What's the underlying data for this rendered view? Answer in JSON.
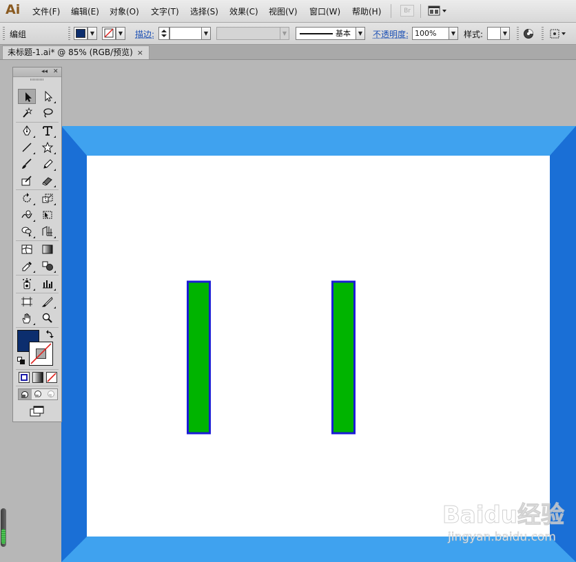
{
  "app": {
    "logo": "Ai"
  },
  "menu": [
    {
      "label": "文件(F)"
    },
    {
      "label": "编辑(E)"
    },
    {
      "label": "对象(O)"
    },
    {
      "label": "文字(T)"
    },
    {
      "label": "选择(S)"
    },
    {
      "label": "效果(C)"
    },
    {
      "label": "视图(V)"
    },
    {
      "label": "窗口(W)"
    },
    {
      "label": "帮助(H)"
    }
  ],
  "menubar_extra": {
    "bridge_label": "Br"
  },
  "control": {
    "selection_label": "编组",
    "fill_color": "#0c2e6e",
    "stroke_label": "描边:",
    "stroke_profile": "基本",
    "opacity_label": "不透明度:",
    "opacity_value": "100%",
    "style_label": "样式:"
  },
  "document_tab": {
    "title": "未标题-1.ai* @ 85% (RGB/预览)",
    "close": "×"
  },
  "artwork": {
    "frame_outer_color": "#1a6fd6",
    "frame_inner_color": "#3fa2ef",
    "page_color": "#ffffff",
    "bar_fill": "#00b400",
    "bar_stroke": "#1c1cd6"
  },
  "tools_panel": {
    "collapse": "◂◂",
    "close": "✕",
    "tools": [
      {
        "name": "selection-tool-icon"
      },
      {
        "name": "direct-selection-tool-icon"
      },
      {
        "name": "magic-wand-tool-icon"
      },
      {
        "name": "lasso-tool-icon"
      },
      {
        "name": "pen-tool-icon"
      },
      {
        "name": "type-tool-icon"
      },
      {
        "name": "line-segment-tool-icon"
      },
      {
        "name": "star-tool-icon"
      },
      {
        "name": "paintbrush-tool-icon"
      },
      {
        "name": "pencil-tool-icon"
      },
      {
        "name": "blob-brush-tool-icon"
      },
      {
        "name": "eraser-tool-icon"
      },
      {
        "name": "rotate-tool-icon"
      },
      {
        "name": "scale-tool-icon"
      },
      {
        "name": "warp-tool-icon"
      },
      {
        "name": "free-transform-tool-icon"
      },
      {
        "name": "shape-builder-tool-icon"
      },
      {
        "name": "perspective-grid-tool-icon"
      },
      {
        "name": "mesh-tool-icon"
      },
      {
        "name": "gradient-tool-icon"
      },
      {
        "name": "eyedropper-tool-icon"
      },
      {
        "name": "blend-tool-icon"
      },
      {
        "name": "symbol-sprayer-tool-icon"
      },
      {
        "name": "column-graph-tool-icon"
      },
      {
        "name": "artboard-tool-icon"
      },
      {
        "name": "slice-tool-icon"
      },
      {
        "name": "hand-tool-icon"
      },
      {
        "name": "zoom-tool-icon"
      }
    ],
    "fill_swatch": "#0c2e6e"
  },
  "watermark": {
    "brand": "Baidu经验",
    "url": "jingyan.baidu.com"
  }
}
